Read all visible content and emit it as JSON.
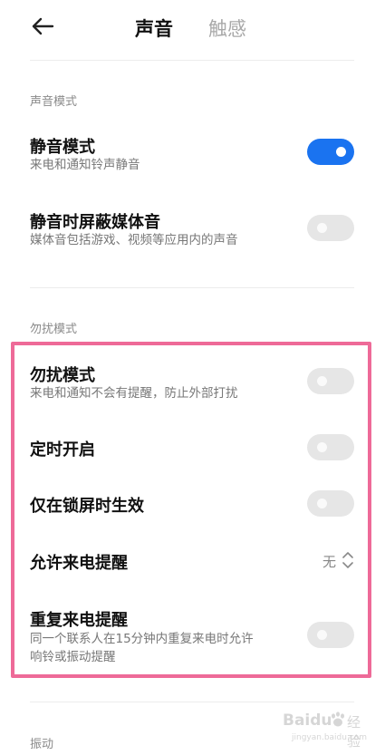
{
  "header": {
    "tabs": [
      {
        "label": "声音",
        "active": true
      },
      {
        "label": "触感",
        "active": false
      }
    ]
  },
  "sections": {
    "sound_mode": {
      "label": "声音模式",
      "items": [
        {
          "title": "静音模式",
          "description": "来电和通知铃声静音",
          "enabled": true
        },
        {
          "title": "静音时屏蔽媒体音",
          "description": "媒体音包括游戏、视频等应用内的声音",
          "enabled": false
        }
      ]
    },
    "dnd_mode": {
      "label": "勿扰模式",
      "items": [
        {
          "title": "勿扰模式",
          "description": "来电和通知不会有提醒，防止外部打扰",
          "enabled": false
        },
        {
          "title": "定时开启",
          "enabled": false
        },
        {
          "title": "仅在锁屏时生效",
          "enabled": false
        },
        {
          "title": "允许来电提醒",
          "value": "无"
        },
        {
          "title": "重复来电提醒",
          "description_line1": "同一个联系人在15分钟内重复来电时允许",
          "description_line2": "响铃或振动提醒",
          "enabled": false
        }
      ]
    },
    "vibration": {
      "label": "振动"
    }
  },
  "colors": {
    "toggle_on": "#1a73f0",
    "toggle_off": "#e6e6e6",
    "highlight_border": "#ee6a98"
  },
  "watermark": {
    "brand": "Baidu",
    "suffix": "经验",
    "url": "jingyan.baidu.com"
  }
}
